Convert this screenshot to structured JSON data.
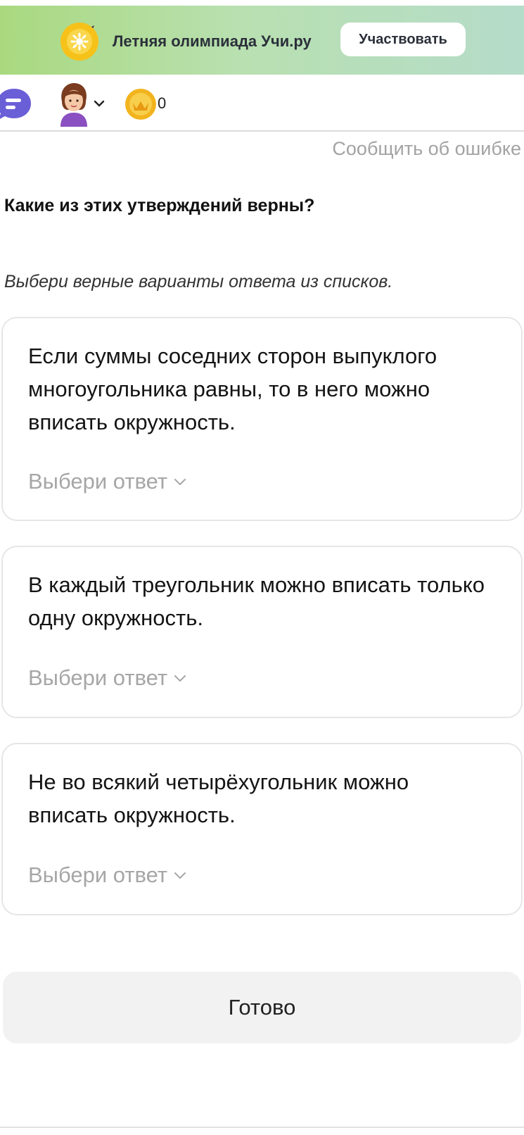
{
  "banner": {
    "text": "Летняя олимпиада Учи.ру",
    "button_label": "Участвовать",
    "colors": {
      "start": "#a9d97f",
      "end": "#b5dcc9"
    }
  },
  "topbar": {
    "icons": [
      "chat-icon",
      "avatar",
      "chevron-down-icon",
      "coin-icon"
    ],
    "coins": "0"
  },
  "report_link": "Сообщить об ошибке",
  "question": {
    "title": "Какие из этих утверждений верны?",
    "hint": "Выбери верные варианты ответа из списков."
  },
  "statements": [
    {
      "text": "Если суммы соседних сторон выпуклого многоугольника равны, то в него можно вписать окружность.",
      "select_label": "Выбери ответ"
    },
    {
      "text": "В каждый треугольник можно вписать только одну окружность.",
      "select_label": "Выбери ответ"
    },
    {
      "text": "Не во всякий четырёхугольник можно вписать окружность.",
      "select_label": "Выбери ответ"
    }
  ],
  "done_button": "Готово"
}
